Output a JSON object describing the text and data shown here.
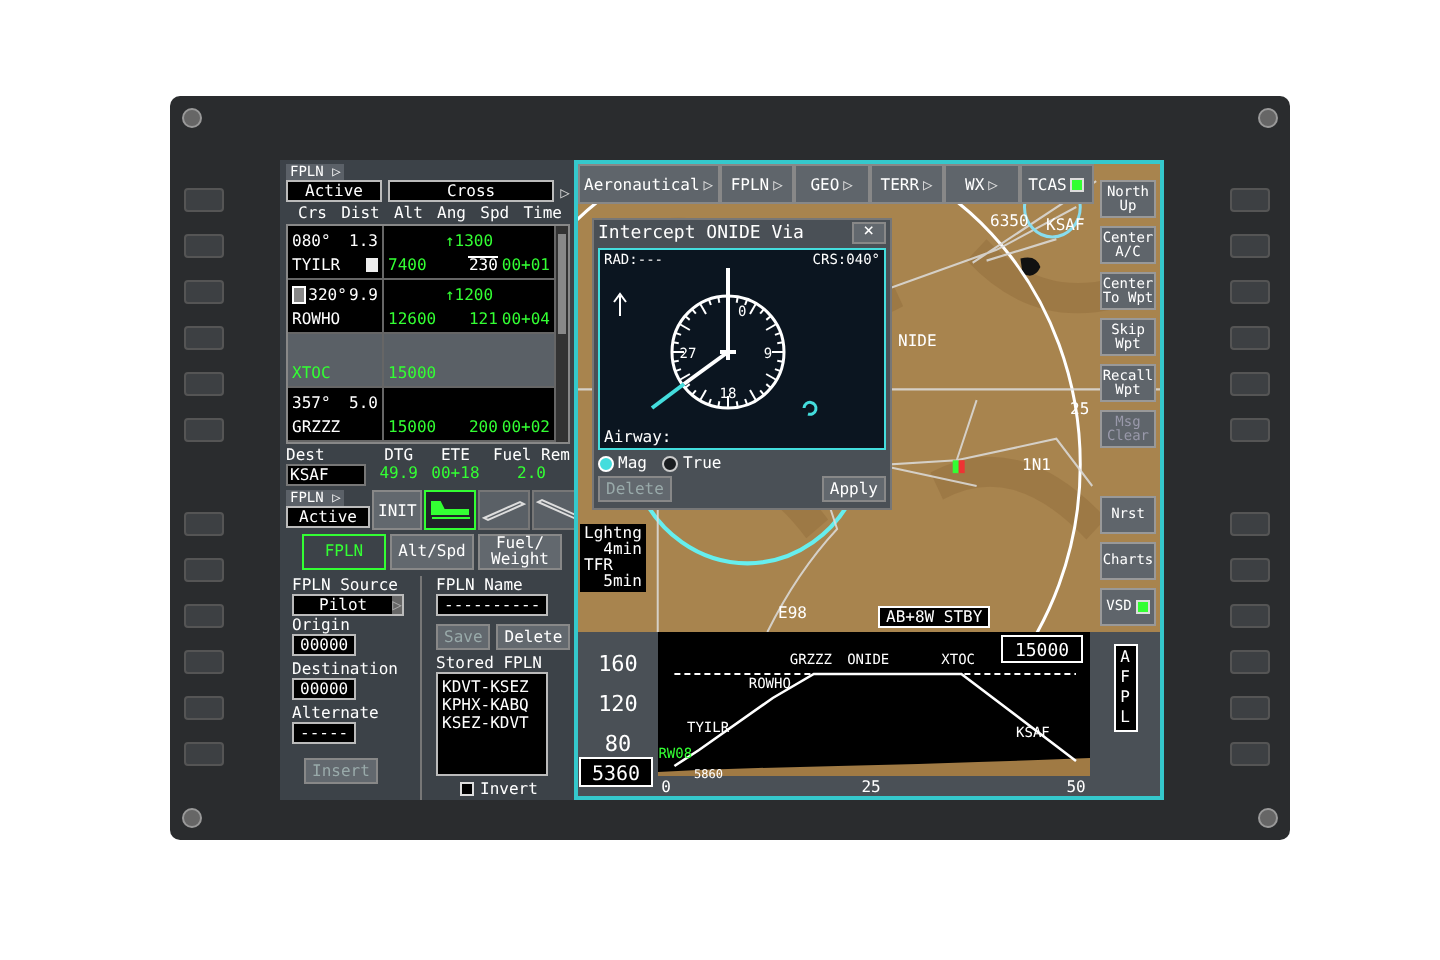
{
  "fpln_header": {
    "tab": "FPLN",
    "tab_arrow": "▷",
    "mode": "Active",
    "constraint": "Cross",
    "constraint_arrow": "▷"
  },
  "columns": [
    "Crs",
    "Dist",
    "Alt",
    "Ang",
    "Spd",
    "Time"
  ],
  "legs": [
    {
      "kind": "waypoint",
      "selected": false,
      "course": "080°",
      "distance": "1.3",
      "angle": "↑1300",
      "name": "TYILR",
      "fly_over": true,
      "leg_icon": false,
      "altitude": "7400",
      "speed": "230",
      "speed_constrained": true,
      "time": "00+01"
    },
    {
      "kind": "waypoint",
      "selected": false,
      "course": "320°",
      "distance": "9.9",
      "angle": "↑1200",
      "name": "ROWHO",
      "fly_over": false,
      "leg_icon": true,
      "altitude": "12600",
      "speed": "121",
      "speed_constrained": false,
      "time": "00+04"
    },
    {
      "kind": "pseudo",
      "selected": true,
      "name": "XTOC",
      "altitude": "15000"
    },
    {
      "kind": "waypoint",
      "selected": false,
      "course": "357°",
      "distance": "5.0",
      "name": "GRZZZ",
      "fly_over": false,
      "leg_icon": false,
      "altitude": "15000",
      "speed": "200",
      "speed_constrained": false,
      "time": "00+02"
    }
  ],
  "summary": {
    "dest_label": "Dest",
    "dest": "KSAF",
    "dtg_label": "DTG",
    "dtg": "49.9",
    "ete_label": "ETE",
    "ete": "00+18",
    "fuel_label": "Fuel Rem",
    "fuel": "2.0"
  },
  "toolbar": {
    "fpln_label": "FPLN",
    "fpln_arrow": "▷",
    "fpln_mode": "Active",
    "init": "INIT",
    "phases": [
      {
        "kind": "taxi",
        "selected": true
      },
      {
        "kind": "takeoff",
        "selected": false
      },
      {
        "kind": "landing",
        "selected": false
      }
    ]
  },
  "tabs": [
    {
      "label": "FPLN",
      "selected": true
    },
    {
      "label": "Alt/Spd",
      "selected": false
    },
    {
      "label": "Fuel/ Weight",
      "selected": false
    }
  ],
  "form": {
    "source_label": "FPLN Source",
    "source": "Pilot",
    "source_arrow": "▷",
    "origin_label": "Origin",
    "origin": "00000",
    "destination_label": "Destination",
    "destination": "00000",
    "alternate_label": "Alternate",
    "alternate": "-----",
    "insert": {
      "label": "Insert",
      "disabled": true
    },
    "name_label": "FPLN Name",
    "name": "----------",
    "save": {
      "label": "Save",
      "disabled": true
    },
    "delete": {
      "label": "Delete",
      "disabled": false
    },
    "stored_label": "Stored FPLN",
    "stored": [
      "KDVT-KSEZ",
      "KPHX-KABQ",
      "KSEZ-KDVT"
    ],
    "invert": {
      "label": "Invert",
      "checked": false
    }
  },
  "map_tabs": [
    {
      "kind": "menu",
      "label": "Aeronautical",
      "arrow": "▷"
    },
    {
      "kind": "menu",
      "label": "FPLN",
      "arrow": "▷"
    },
    {
      "kind": "menu",
      "label": "GEO",
      "arrow": "▷"
    },
    {
      "kind": "menu",
      "label": "TERR",
      "arrow": "▷"
    },
    {
      "kind": "menu",
      "label": "WX",
      "arrow": "▷"
    },
    {
      "kind": "toggle",
      "label": "TCAS",
      "checked": true
    }
  ],
  "map_buttons": [
    {
      "kind": "button",
      "label": "North Up",
      "disabled": false
    },
    {
      "kind": "button",
      "label": "Center A/C",
      "disabled": false
    },
    {
      "kind": "button",
      "label": "Center To Wpt",
      "disabled": false
    },
    {
      "kind": "button",
      "label": "Skip Wpt",
      "disabled": false
    },
    {
      "kind": "button",
      "label": "Recall Wpt",
      "disabled": false
    },
    {
      "kind": "button",
      "label": "Msg Clear",
      "disabled": true
    },
    {
      "kind": "button",
      "label": "Nrst",
      "disabled": false
    },
    {
      "kind": "button",
      "label": "Charts",
      "disabled": false
    },
    {
      "kind": "toggle",
      "label": "VSD",
      "checked": true
    }
  ],
  "map_labels": [
    "6350",
    "KSAF",
    "NIDE",
    "1N1",
    "E98",
    "25"
  ],
  "status_tag": "AB+8W STBY",
  "wx_legend": [
    {
      "label": "Lghtng",
      "value": "4min"
    },
    {
      "label": "TFR",
      "value": "5min"
    }
  ],
  "dialog": {
    "title": "Intercept ONIDE Via",
    "close": "×",
    "radial": "RAD:---",
    "course": "CRS:040°",
    "compass_labels": [
      "0",
      "9",
      "18",
      "27"
    ],
    "airway_label": "Airway:",
    "references": [
      {
        "label": "Mag",
        "selected": true
      },
      {
        "label": "True",
        "selected": false
      }
    ],
    "delete": {
      "label": "Delete",
      "disabled": true
    },
    "apply": {
      "label": "Apply",
      "disabled": false
    }
  },
  "vsd": {
    "altitude_box": "15000",
    "current_altitude": "5360",
    "field_elevation": "5860",
    "afpl": "AFPL",
    "chart_data": {
      "type": "line",
      "x": [
        1,
        4,
        13,
        18,
        25,
        36,
        50
      ],
      "xlim": [
        -1,
        51.7
      ],
      "ylim": [
        48,
        192
      ],
      "xticks": [
        0,
        25,
        50
      ],
      "yticks": [
        {
          "value": 80,
          "label": "80"
        },
        {
          "value": 120,
          "label": "120"
        },
        {
          "value": 160,
          "label": "160"
        }
      ],
      "series": [
        {
          "color": "#ffffff",
          "values": [
            58,
            74,
            126,
            150,
            150,
            150,
            63
          ]
        },
        {
          "color": "#ffffff",
          "line_style": "dashed",
          "values": [
            150,
            150,
            150,
            150,
            150,
            150,
            150
          ]
        }
      ],
      "annotations": [
        {
          "x": 1,
          "y": 58,
          "text": "RW08"
        },
        {
          "x": 4,
          "y": 74,
          "text": "TYILR"
        },
        {
          "x": 13,
          "y": 126,
          "text": "ROWHO"
        },
        {
          "x": 18,
          "y": 150,
          "text": "GRZZZ"
        },
        {
          "x": 25,
          "y": 150,
          "text": "ONIDE"
        },
        {
          "x": 36,
          "y": 150,
          "text": "XTOC"
        },
        {
          "x": 50,
          "y": 63,
          "text": "KSAF"
        }
      ]
    }
  }
}
